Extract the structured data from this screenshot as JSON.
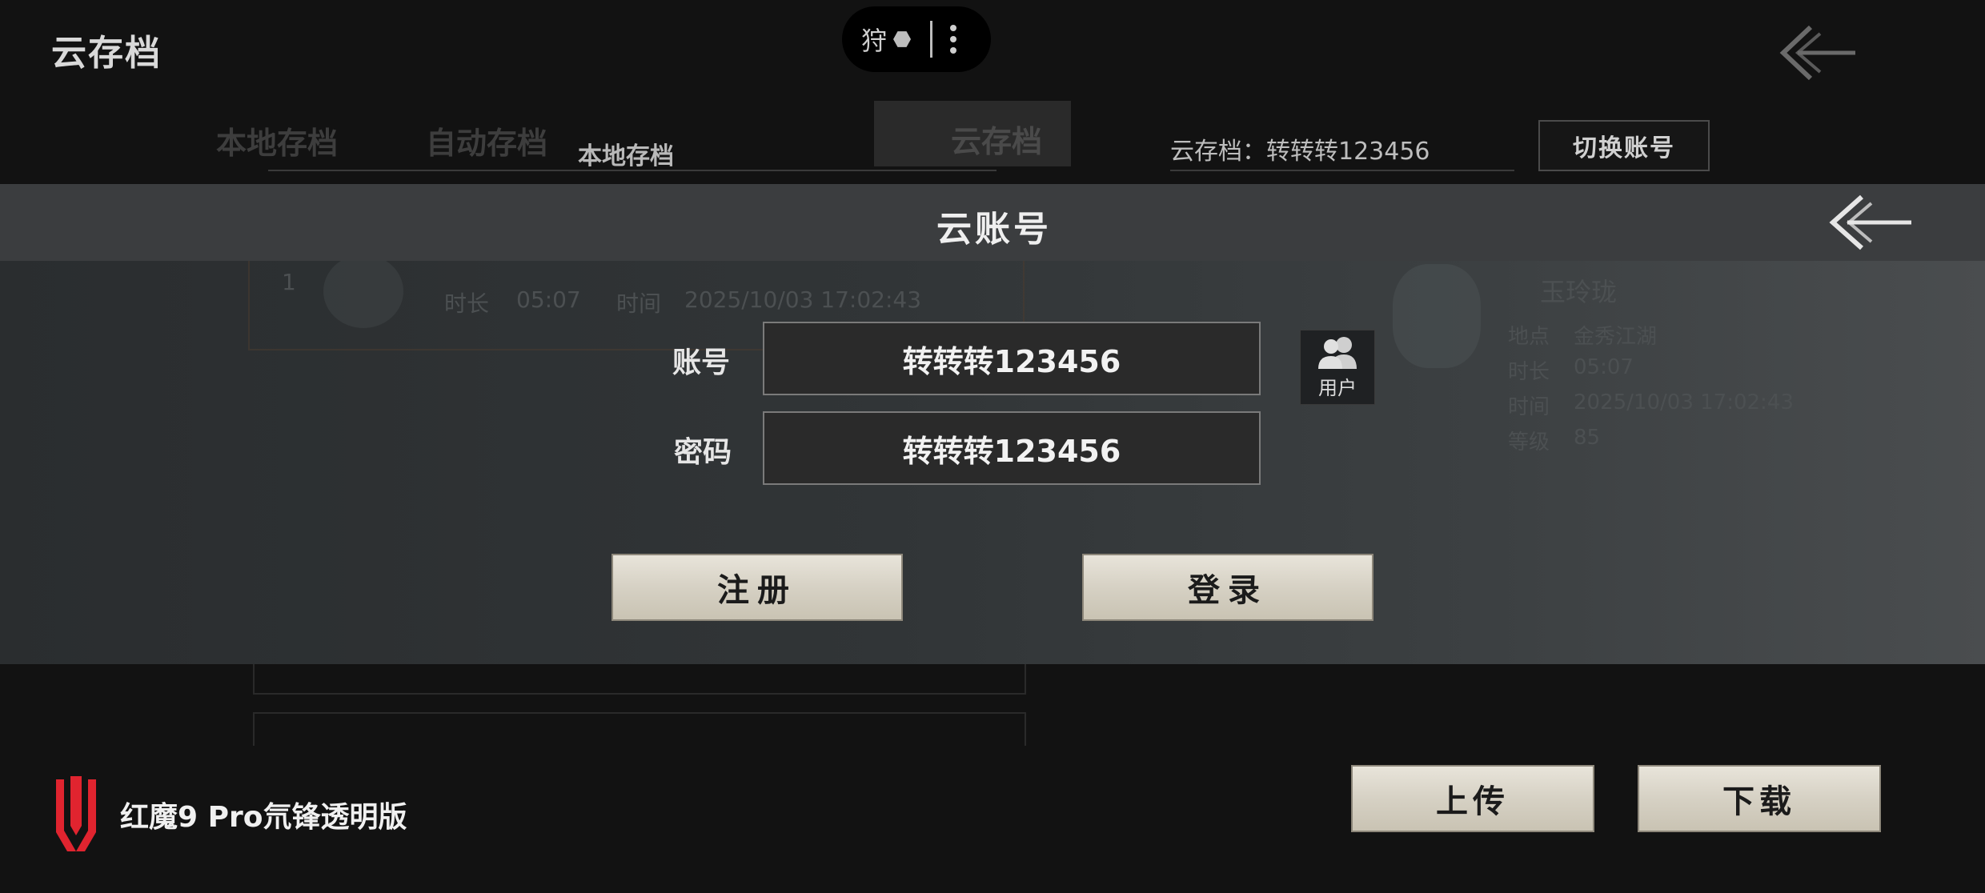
{
  "header": {
    "title": "云存档",
    "game_label": "狩"
  },
  "background": {
    "tabs": [
      "本地存档",
      "自动存档"
    ],
    "active_tab": "云存档",
    "local_label": "本地存档",
    "cloud_account": "云存档：转转转123456",
    "switch_account": "切换账号",
    "ghost": {
      "slot_no": "1",
      "time_label": "时长",
      "time_value": "05:07",
      "date_label": "时间",
      "date_value": "2025/10/03 17:02:43",
      "char_name": "玉玲珑",
      "r1_label": "地点",
      "r1_value": "金秀江湖",
      "r2_label": "时长",
      "r2_value": "05:07",
      "r3_label": "时间",
      "r3_value": "2025/10/03 17:02:43",
      "r4_label": "等级",
      "r4_value": "85"
    }
  },
  "modal": {
    "title": "云账号",
    "account_label": "账号",
    "account_value": "转转转123456",
    "password_label": "密码",
    "password_value": "转转转123456",
    "user_button": "用户",
    "register": "注册",
    "login": "登录"
  },
  "footer": {
    "upload": "上传",
    "download": "下载",
    "device": "红魔9 Pro氘锋透明版"
  },
  "colors": {
    "brand_red": "#e0242f",
    "paper": "#d6d1c4"
  }
}
